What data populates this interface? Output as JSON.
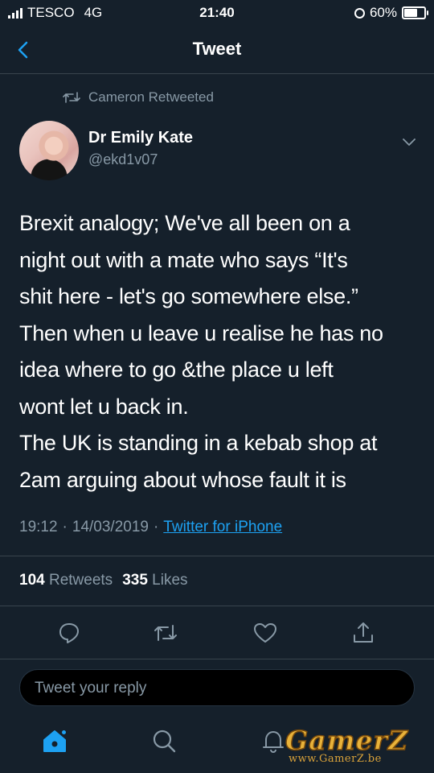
{
  "status_bar": {
    "carrier": "TESCO",
    "network": "4G",
    "time": "21:40",
    "battery": "60%",
    "battery_level": 0.6
  },
  "nav": {
    "title": "Tweet"
  },
  "retweet_label": "Cameron Retweeted",
  "author": {
    "name": "Dr Emily Kate",
    "handle": "@ekd1v07"
  },
  "tweet": {
    "lines": [
      "Brexit analogy; We've all been on a",
      "night out with a mate who says “It's",
      "shit here - let's go somewhere else.”",
      "Then when u leave u realise he has no",
      "idea where to go &the place u left",
      "wont let u back in.",
      "The UK is standing in a kebab shop at",
      "2am arguing about whose fault it is"
    ]
  },
  "meta": {
    "time": "19:12",
    "sep1": "·",
    "date": "14/03/2019",
    "sep2": "·",
    "source": "Twitter for iPhone"
  },
  "stats": {
    "retweets_count": "104",
    "retweets_label": "Retweets",
    "likes_count": "335",
    "likes_label": "Likes"
  },
  "reply": {
    "placeholder": "Tweet your reply"
  },
  "watermark": {
    "logo": "GamerZ",
    "url": "www.GamerZ.be"
  },
  "icons": {
    "back": "chevron-left-icon",
    "retweeted": "retweet-icon",
    "more": "chevron-down-icon",
    "reply": "comment-icon",
    "retweet": "retweet-icon",
    "like": "heart-icon",
    "share": "share-icon",
    "home": "home-icon",
    "search": "search-icon",
    "notifications": "bell-icon"
  },
  "colors": {
    "background": "#15202b",
    "accent": "#1da1f2",
    "secondary_text": "#8899a6",
    "divider": "#38444d"
  }
}
